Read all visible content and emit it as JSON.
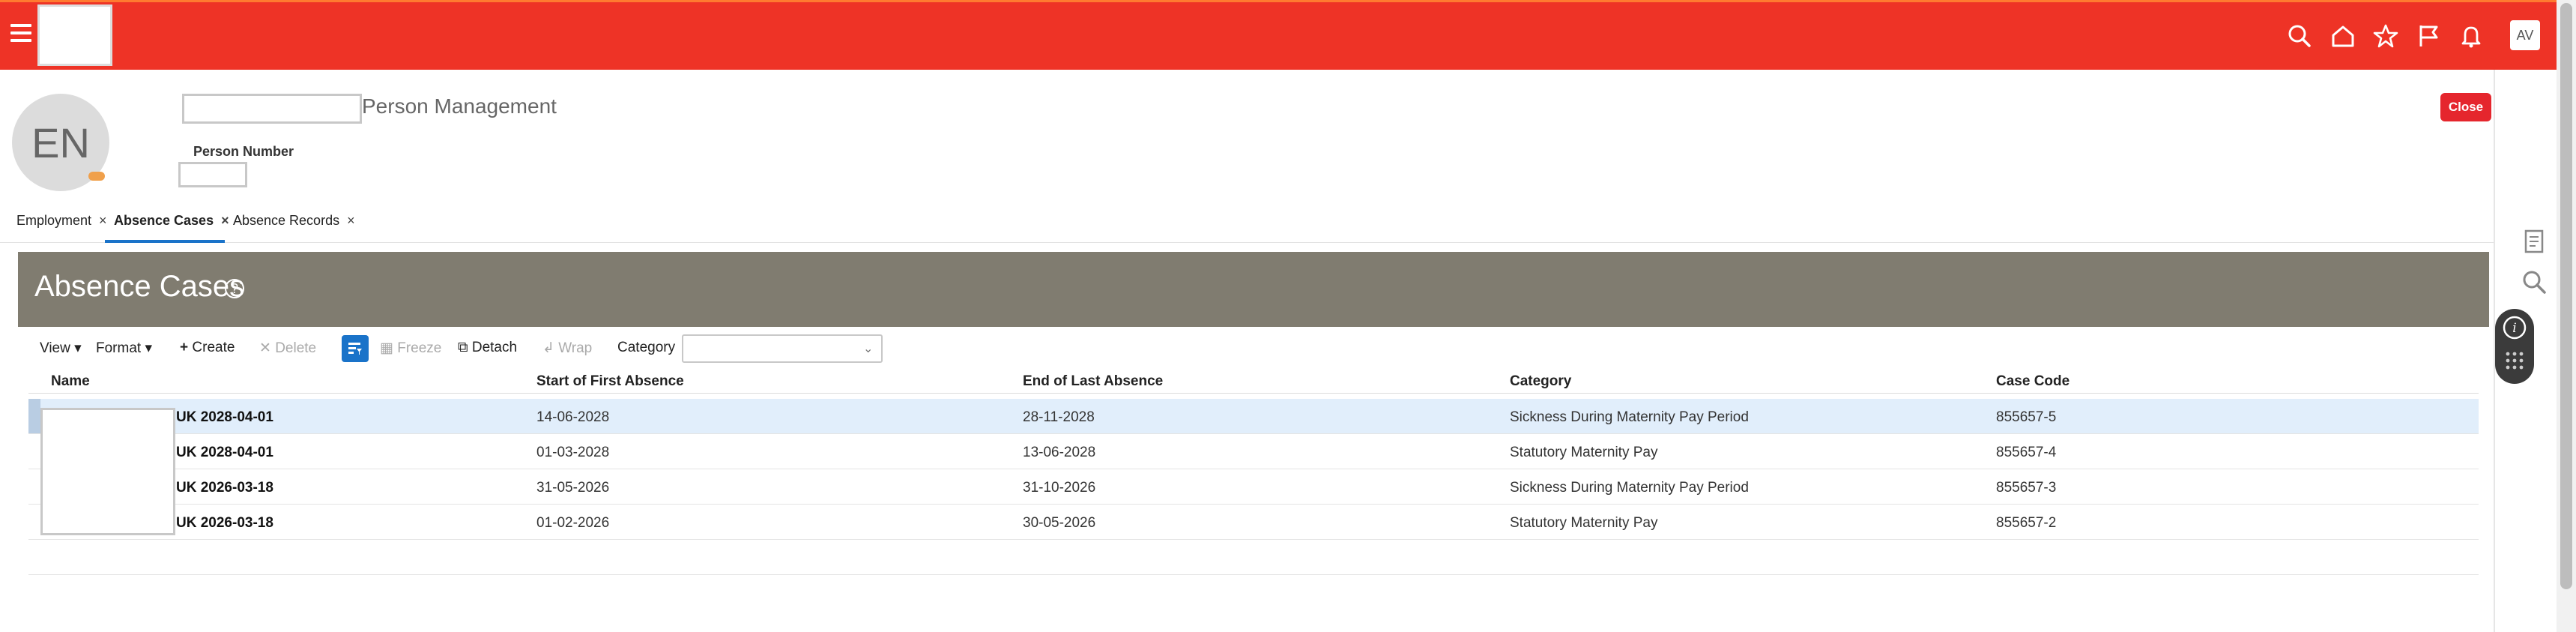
{
  "header": {
    "avatar_initials": "AV",
    "icons": [
      "menu-icon",
      "search-icon",
      "home-icon",
      "star-icon",
      "flag-icon",
      "bell-icon"
    ],
    "brand_color": "#ee3326"
  },
  "person": {
    "initials": "EN",
    "page_title": "Person Management",
    "person_number_label": "Person Number",
    "close_label": "Close"
  },
  "tabs": [
    {
      "label": "Employment",
      "active": false
    },
    {
      "label": "Absence Cases",
      "active": true
    },
    {
      "label": "Absence Records",
      "active": false
    }
  ],
  "panel": {
    "title": "Absence Cases",
    "help_glyph": "?"
  },
  "toolbar": {
    "view_label": "View",
    "format_label": "Format",
    "create_label": "Create",
    "delete_label": "Delete",
    "freeze_label": "Freeze",
    "detach_label": "Detach",
    "wrap_label": "Wrap",
    "category_label": "Category",
    "category_value": ""
  },
  "table": {
    "columns": [
      "Name",
      "Start of First Absence",
      "End of Last Absence",
      "Category",
      "Case Code"
    ],
    "rows": [
      {
        "name": "UK 2028-04-01",
        "start": "14-06-2028",
        "end": "28-11-2028",
        "category": "Sickness During Maternity Pay Period",
        "code": "855657-5",
        "selected": true
      },
      {
        "name": "UK 2028-04-01",
        "start": "01-03-2028",
        "end": "13-06-2028",
        "category": "Statutory Maternity Pay",
        "code": "855657-4",
        "selected": false
      },
      {
        "name": "UK 2026-03-18",
        "start": "31-05-2026",
        "end": "31-10-2026",
        "category": "Sickness During Maternity Pay Period",
        "code": "855657-3",
        "selected": false
      },
      {
        "name": "UK 2026-03-18",
        "start": "01-02-2026",
        "end": "30-05-2026",
        "category": "Statutory Maternity Pay",
        "code": "855657-2",
        "selected": false
      }
    ]
  },
  "side": {
    "icons": [
      "document-icon",
      "magnifier-icon",
      "info-icon",
      "keypad-icon"
    ]
  }
}
